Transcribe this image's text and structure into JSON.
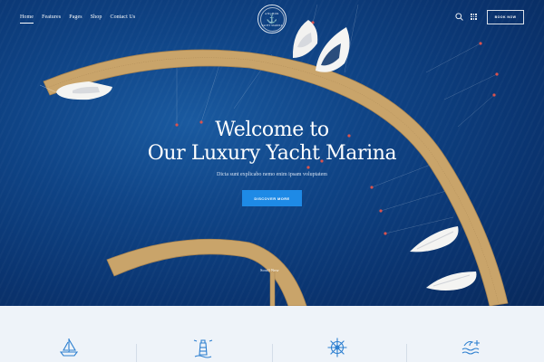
{
  "nav": {
    "items": [
      {
        "label": "Home",
        "active": true
      },
      {
        "label": "Features",
        "active": false
      },
      {
        "label": "Pages",
        "active": false
      },
      {
        "label": "Shop",
        "active": false
      },
      {
        "label": "Contact Us",
        "active": false
      }
    ]
  },
  "logo": {
    "top_text": "ANCHOR",
    "bottom_text": "YACHT MARINA",
    "icon": "anchor-icon"
  },
  "header": {
    "book_button": "BOOK NOW",
    "search_icon": "search-icon",
    "menu_icon": "grid-menu-icon"
  },
  "hero": {
    "title_line1": "Welcome to",
    "title_line2": "Our Luxury Yacht Marina",
    "subtitle": "Dicta sunt explicabo nemo enim ipsam voluptatem",
    "cta_label": "DISCOVER MORE",
    "scroll_label": "Scroll Now"
  },
  "features": {
    "icons": [
      "sailboat-icon",
      "lighthouse-icon",
      "ship-wheel-icon",
      "sea-waves-icon"
    ]
  },
  "colors": {
    "water": "#0f4486",
    "accent": "#1e8ae6",
    "pier": "#c9a46a",
    "feature_bg": "#eef3f9",
    "feature_icon": "#2c7fd0"
  }
}
